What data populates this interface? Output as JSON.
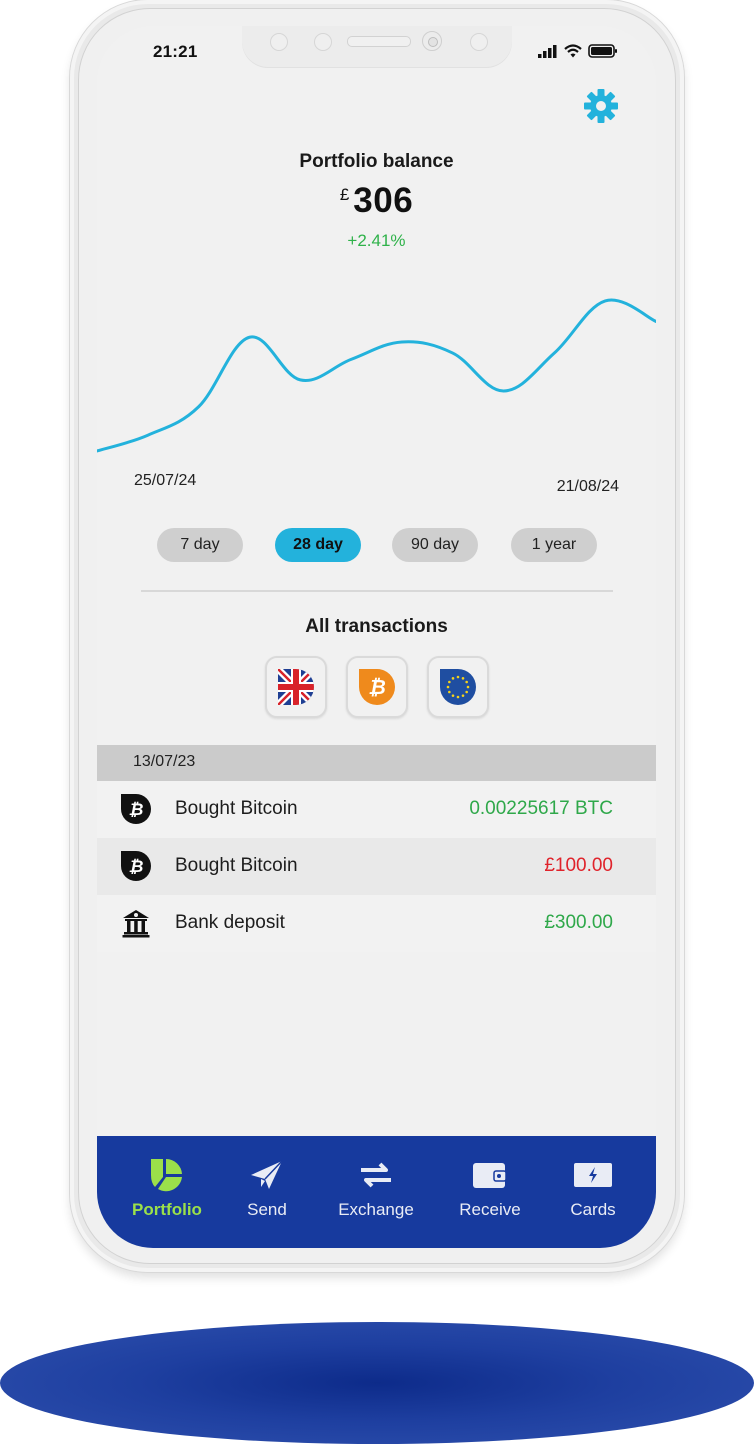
{
  "status_bar": {
    "time": "21:21",
    "icons": [
      "signal-icon",
      "wifi-icon",
      "battery-icon"
    ]
  },
  "header": {
    "settings_icon": "gear-icon",
    "settings_color": "#23b2dc"
  },
  "balance": {
    "title": "Portfolio balance",
    "currency": "£",
    "amount": "306",
    "change": "+2.41%",
    "change_color": "#2fb24a"
  },
  "chart": {
    "start_date": "25/07/24",
    "end_date": "21/08/24",
    "line_color": "#23b2dc"
  },
  "chart_data": {
    "type": "line",
    "title": "",
    "xlabel": "",
    "ylabel": "",
    "x_labels": [
      "25/07/24",
      "21/08/24"
    ],
    "series": [
      {
        "name": "Portfolio balance",
        "values": [
          0.0,
          0.1,
          0.28,
          0.72,
          0.45,
          0.58,
          0.69,
          0.62,
          0.38,
          0.62,
          0.95,
          0.82
        ]
      }
    ],
    "ylim": [
      0,
      1
    ],
    "grid": false,
    "legend": "none"
  },
  "ranges": [
    {
      "label": "7 day",
      "active": false
    },
    {
      "label": "28 day",
      "active": true
    },
    {
      "label": "90 day",
      "active": false
    },
    {
      "label": "1 year",
      "active": false
    }
  ],
  "transactions": {
    "title": "All transactions",
    "filters": [
      {
        "name": "gbp-flag-icon",
        "label": "GBP"
      },
      {
        "name": "bitcoin-icon",
        "label": "BTC"
      },
      {
        "name": "eu-flag-icon",
        "label": "EUR"
      }
    ],
    "groups": [
      {
        "date": "13/07/23",
        "items": [
          {
            "icon": "bitcoin-icon",
            "label": "Bought Bitcoin",
            "amount": "0.00225617 BTC",
            "color": "#2fa84a"
          },
          {
            "icon": "bitcoin-icon",
            "label": "Bought Bitcoin",
            "amount": "£100.00",
            "color": "#e0232b"
          },
          {
            "icon": "bank-icon",
            "label": "Bank deposit",
            "amount": "£300.00",
            "color": "#2fa84a"
          }
        ]
      }
    ]
  },
  "nav": {
    "background": "#173a9e",
    "active_color": "#9be04a",
    "items": [
      {
        "label": "Portfolio",
        "icon": "pie-chart-icon",
        "active": true
      },
      {
        "label": "Send",
        "icon": "paper-plane-icon",
        "active": false
      },
      {
        "label": "Exchange",
        "icon": "exchange-arrows-icon",
        "active": false
      },
      {
        "label": "Receive",
        "icon": "wallet-icon",
        "active": false
      },
      {
        "label": "Cards",
        "icon": "card-icon",
        "active": false
      }
    ]
  }
}
